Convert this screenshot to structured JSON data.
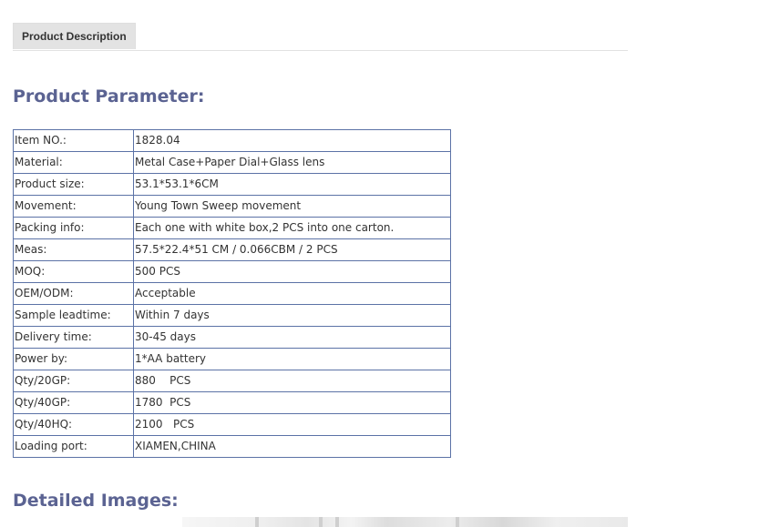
{
  "tabs": {
    "product_description": "Product Description"
  },
  "sections": {
    "parameter_title": "Product Parameter:",
    "images_title": "Detailed Images:"
  },
  "params": [
    {
      "label": "Item NO.:",
      "value": "1828.04"
    },
    {
      "label": "Material:",
      "value": "Metal Case+Paper Dial+Glass lens"
    },
    {
      "label": "Product size:",
      "value": "53.1*53.1*6CM"
    },
    {
      "label": "Movement:",
      "value": "Young Town Sweep movement"
    },
    {
      "label": "Packing info:",
      "value": "Each one with white box,2 PCS into one carton."
    },
    {
      "label": "Meas:",
      "value": "57.5*22.4*51 CM / 0.066CBM / 2 PCS"
    },
    {
      "label": "MOQ:",
      "value": "500 PCS"
    },
    {
      "label": "OEM/ODM:",
      "value": "Acceptable"
    },
    {
      "label": "Sample leadtime:",
      "value": "Within 7 days"
    },
    {
      "label": "Delivery time:",
      "value": "30-45 days"
    },
    {
      "label": "Power by:",
      "value": "1*AA battery"
    },
    {
      "label": "Qty/20GP:",
      "value": "880    PCS"
    },
    {
      "label": "Qty/40GP:",
      "value": "1780  PCS"
    },
    {
      "label": "Qty/40HQ:",
      "value": "2100   PCS"
    },
    {
      "label": "Loading port:",
      "value": "XIAMEN,CHINA"
    }
  ],
  "colors": {
    "title": "#5b6392",
    "table_border": "#5b72a6",
    "tab_background": "#e3e3e3"
  }
}
